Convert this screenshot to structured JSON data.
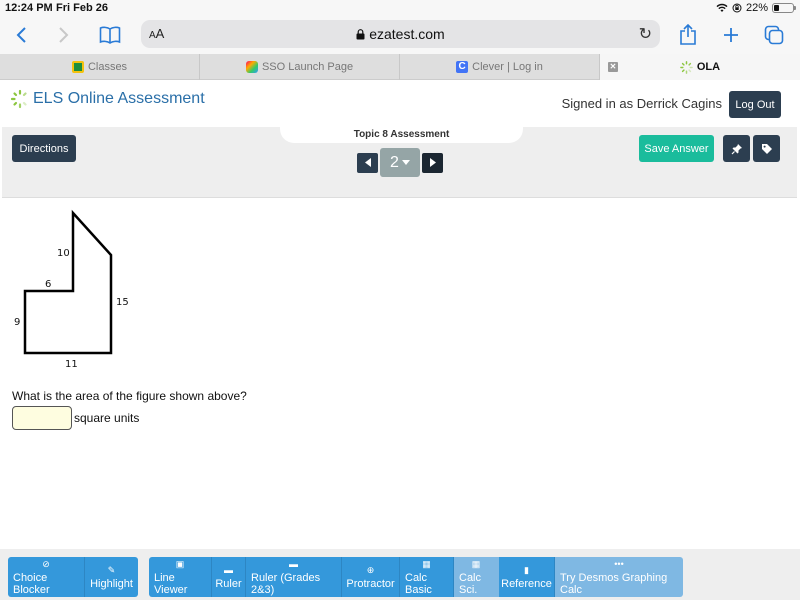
{
  "status_bar": {
    "time": "12:24 PM",
    "date": "Fri Feb 26",
    "battery": "22%",
    "icons": [
      "wifi-icon",
      "orientation-lock-icon",
      "battery-icon"
    ]
  },
  "browser": {
    "text_size_label_small": "A",
    "text_size_label_large": "A",
    "url": "ezatest.com",
    "icons": {
      "back": "‹",
      "forward": "›",
      "bookmarks": "📖",
      "lock": "🔒",
      "reload": "↻",
      "share": "⇪",
      "new_tab": "+",
      "tabs": "❐"
    }
  },
  "tabs": [
    {
      "label": "Classes",
      "active": false
    },
    {
      "label": "SSO Launch Page",
      "active": false
    },
    {
      "label": "Clever | Log in",
      "active": false
    },
    {
      "label": "OLA",
      "active": true
    }
  ],
  "header": {
    "app_title": "ELS Online Assessment",
    "signed_in_text": "Signed in as Derrick Cagins",
    "logout_label": "Log Out"
  },
  "controls": {
    "directions_label": "Directions",
    "assessment_title": "Topic 8 Assessment",
    "current_question": "2",
    "prev_label": "◀",
    "next_label": "▶",
    "caret": "▼",
    "save_label": "Save Answer",
    "pin_icon": "📌",
    "tag_icon": "🏷"
  },
  "question": {
    "figure_labels": {
      "top_left_side": "10",
      "step": "6",
      "left_side": "9",
      "bottom": "11",
      "right_side": "15"
    },
    "prompt": "What is the area of the figure shown above?",
    "answer_value": "",
    "answer_placeholder": "",
    "units": "square units"
  },
  "toolbar": {
    "group1": [
      {
        "label": "Choice Blocker",
        "icon": "⊘",
        "enabled": true
      },
      {
        "label": "Highlight",
        "icon": "✎",
        "enabled": true
      }
    ],
    "group2": [
      {
        "label": "Line Viewer",
        "icon": "▣",
        "enabled": true
      },
      {
        "label": "Ruler",
        "icon": "▬",
        "enabled": true
      },
      {
        "label": "Ruler (Grades 2&3)",
        "icon": "▬",
        "enabled": true
      },
      {
        "label": "Protractor",
        "icon": "⊕",
        "enabled": true
      },
      {
        "label": "Calc Basic",
        "icon": "▦",
        "enabled": true
      },
      {
        "label": "Calc Sci.",
        "icon": "▦",
        "enabled": false
      },
      {
        "label": "Reference",
        "icon": "▮",
        "enabled": true
      },
      {
        "label": "Try Desmos Graphing Calc",
        "icon": "•••",
        "enabled": false
      }
    ]
  },
  "colors": {
    "primary_dark": "#2c3e50",
    "save_green": "#1abc9c",
    "tool_blue": "#3498db",
    "tool_blue_disabled": "#7fb8e3",
    "page_gray": "#95a5a6",
    "link_blue": "#2a7bd6",
    "logo_blue": "#2a6fa8",
    "answer_bg": "#fefde0"
  }
}
